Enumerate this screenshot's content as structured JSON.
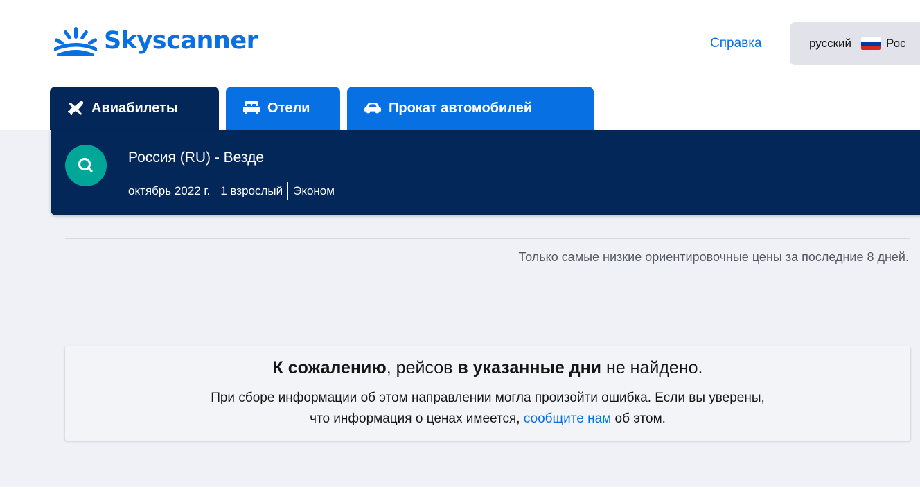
{
  "header": {
    "logo_text": "Skyscanner",
    "help_label": "Справка",
    "locale": {
      "language": "русский",
      "country": "Рос"
    }
  },
  "tabs": [
    {
      "label": "Авиабилеты",
      "icon": "plane-icon",
      "active": true
    },
    {
      "label": "Отели",
      "icon": "bed-icon",
      "active": false
    },
    {
      "label": "Прокат автомобилей",
      "icon": "car-icon",
      "active": false
    }
  ],
  "search": {
    "route": "Россия (RU) - Везде",
    "date": "октябрь 2022 г.",
    "travellers": "1 взрослый",
    "cabin": "Эконом"
  },
  "price_note": "Только самые низкие ориентировочные цены за последние 8 дней.",
  "alert": {
    "title_part1": "К сожалению",
    "title_part2": ", рейсов ",
    "title_part3": "в указанные дни",
    "title_part4": " не найдено.",
    "text_line1": "При сборе информации об этом направлении могла произойти ошибка. Если вы уверены,",
    "text_line2_start": "что информация о ценах имеется, ",
    "link_label": "сообщите нам",
    "text_line2_end": " об этом."
  },
  "colors": {
    "brand_blue": "#0770e3",
    "navy": "#042759",
    "teal": "#00a698",
    "background": "#eff1f6"
  }
}
